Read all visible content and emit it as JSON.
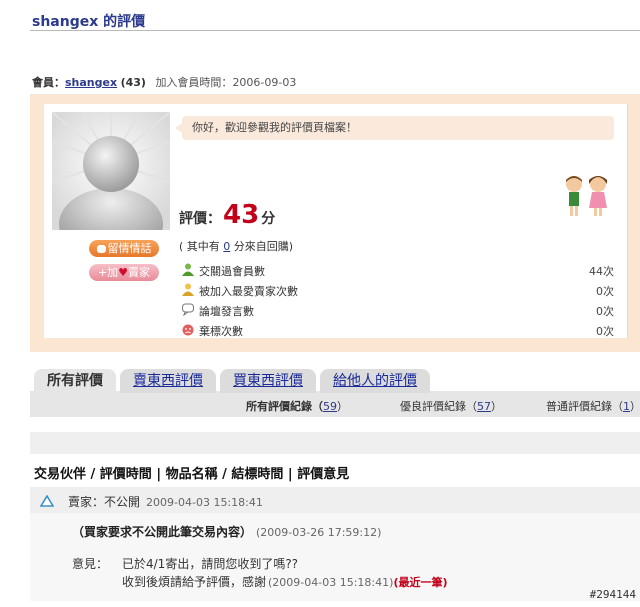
{
  "page": {
    "title": "shangex 的評價"
  },
  "member": {
    "label": "會員：",
    "username": "shangex",
    "count": "(43)",
    "join_label": "加入會員時間：",
    "join_date": "2006-09-03"
  },
  "profile": {
    "greeting": "你好，歡迎參觀我的評價頁檔案！",
    "score_label": "評價：",
    "score": "43",
    "score_unit": "分",
    "sub_prefix": "( 其中有 ",
    "sub_count": "0",
    "sub_suffix": " 分來自回購)",
    "buttons": {
      "message": "留情情話",
      "favorite_prefix": "+加",
      "favorite_heart": "♥",
      "favorite_suffix": "賣家"
    },
    "stats": [
      {
        "name": "交關過會員數",
        "value": "44次",
        "icon": "user-green-icon"
      },
      {
        "name": "被加入最愛賣家次數",
        "value": "0次",
        "icon": "user-yellow-icon"
      },
      {
        "name": "論壇發言數",
        "value": "0次",
        "icon": "speech-bubble-icon"
      },
      {
        "name": "棄標次數",
        "value": "0次",
        "icon": "sad-face-icon"
      }
    ]
  },
  "tabs": [
    {
      "label": "所有評價",
      "active": true
    },
    {
      "label": "賣東西評價",
      "active": false
    },
    {
      "label": "買東西評價",
      "active": false
    },
    {
      "label": "給他人的評價",
      "active": false
    }
  ],
  "summary": {
    "all_label": "所有評價紀錄（",
    "all_count": "59",
    "good_label": "優良評價紀錄（",
    "good_count": "57",
    "normal_label": "普通評價紀錄（",
    "normal_count": "1",
    "close": "）"
  },
  "list": {
    "header": "交易伙伴 / 評價時間 | 物品名稱 / 結標時間 | 評價意見",
    "entries": [
      {
        "who": "賣家：不公開",
        "time": "2009-04-03 15:18:41",
        "item": "（買家要求不公開此筆交易內容）",
        "item_time": "(2009-03-26 17:59:12)",
        "comment_label": "意見：",
        "comment_line1": "已於4/1寄出，請問您收到了嗎??",
        "comment_line2": "收到後煩請給予評價，感謝",
        "comment_time": "(2009-04-03 15:18:41)",
        "latest": "(最近一筆)"
      }
    ]
  },
  "watermark": "#294144",
  "colors": {
    "accent_red": "#c3001a",
    "link_blue": "#2b3a8c",
    "panel_bg": "#fbe6d2"
  }
}
